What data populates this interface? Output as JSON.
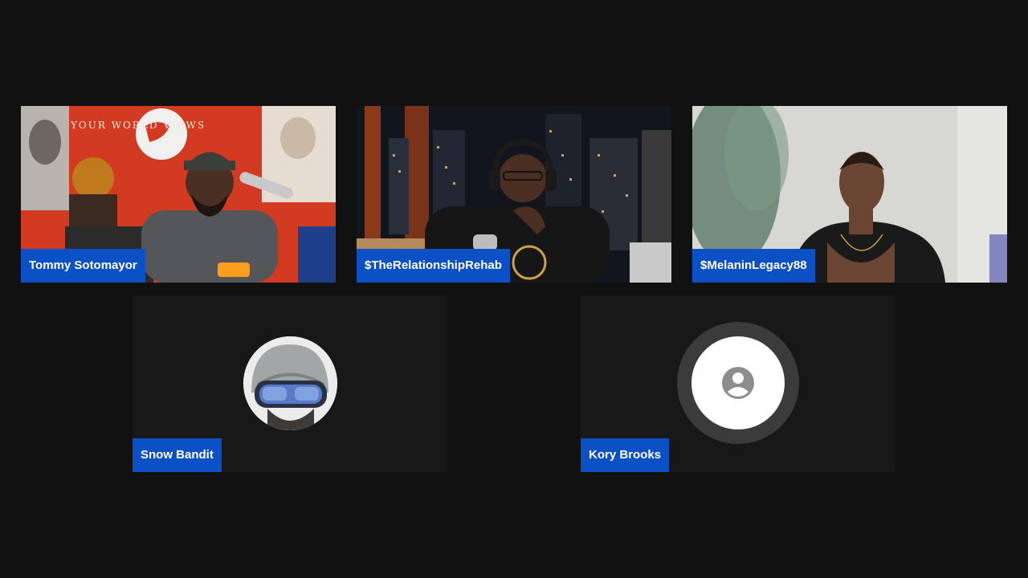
{
  "participants": [
    {
      "name": "Tommy Sotomayor",
      "video": "on"
    },
    {
      "name": "$TheRelationshipRehab",
      "video": "on"
    },
    {
      "name": "$MelaninLegacy88",
      "video": "on"
    },
    {
      "name": "Snow Bandit",
      "video": "off",
      "avatar": "profile-photo"
    },
    {
      "name": "Kory Brooks",
      "video": "off",
      "avatar": "default-person-icon"
    }
  ],
  "backdrop_text": {
    "tile1_sign": "YOUR WORLD VIEWS"
  },
  "colors": {
    "background": "#111111",
    "name_tag": "#0b51c5",
    "empty_tile": "#181818"
  }
}
